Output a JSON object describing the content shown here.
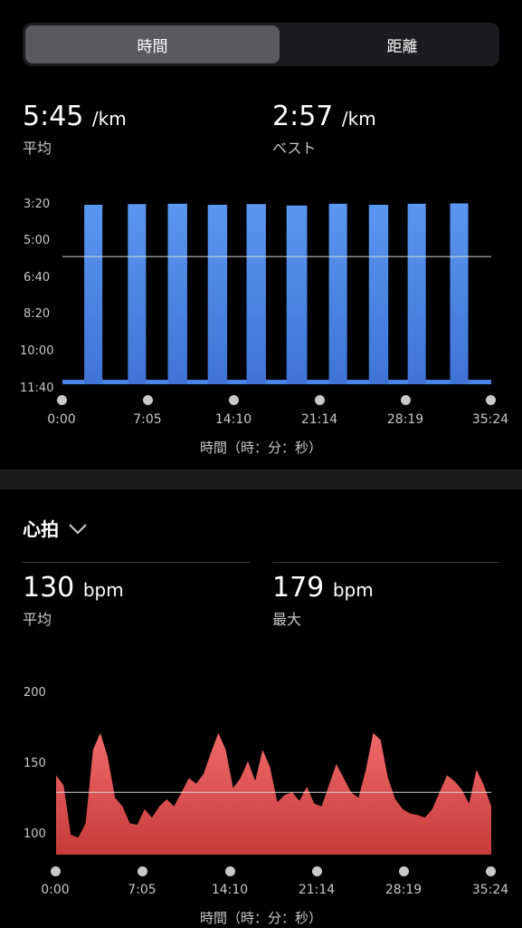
{
  "tabs": [
    {
      "label": "時間",
      "active": true
    },
    {
      "label": "距離",
      "active": false
    }
  ],
  "pace": {
    "average": {
      "value": "5:45",
      "unit": "/km",
      "label": "平均"
    },
    "best": {
      "value": "2:57",
      "unit": "/km",
      "label": "ベスト"
    }
  },
  "heart": {
    "section_title": "心拍",
    "average": {
      "value": "130",
      "unit": "bpm",
      "label": "平均"
    },
    "max": {
      "value": "179",
      "unit": "bpm",
      "label": "最大"
    }
  },
  "colors": {
    "pace": "#4a85e6",
    "heart": "#e04848",
    "background": "#000000"
  },
  "chart_data": [
    {
      "type": "area",
      "x_axis_title": "時間（時：分：秒）",
      "x_ticks": [
        "0:00",
        "7:05",
        "14:10",
        "21:14",
        "28:19",
        "35:24"
      ],
      "y_ticks": [
        "3:20",
        "5:00",
        "6:40",
        "8:20",
        "10:00",
        "11:40"
      ],
      "y_inverted": true,
      "ylim_seconds_per_km": [
        200,
        700
      ],
      "average_line_seconds_per_km": 345,
      "series": [
        {
          "x_min": [
            0,
            1.8,
            3.6,
            5.4,
            7.1,
            8.9,
            10.7,
            12.5,
            14.2,
            16.0,
            17.8,
            19.5,
            21.3,
            23.0,
            24.8,
            26.6,
            28.4,
            30.1,
            31.9,
            33.7,
            35.4
          ],
          "intervals_min": [
            [
              1.8,
              3.3
            ],
            [
              5.4,
              6.9
            ],
            [
              8.7,
              10.3
            ],
            [
              12.0,
              13.6
            ],
            [
              15.2,
              16.8
            ],
            [
              18.5,
              20.2
            ],
            [
              22.0,
              23.5
            ],
            [
              25.3,
              26.9
            ],
            [
              28.5,
              30.0
            ],
            [
              32.0,
              33.5
            ]
          ],
          "interval_pace_seconds_per_km": [
            200,
            198,
            197,
            200,
            198,
            202,
            197,
            200,
            197,
            196
          ],
          "recovery_pace_seconds_per_km": 690
        }
      ]
    },
    {
      "type": "area",
      "x_axis_title": "時間（時：分：秒）",
      "x_ticks": [
        "0:00",
        "7:05",
        "14:10",
        "21:14",
        "28:19",
        "35:24"
      ],
      "y_ticks": [
        "200",
        "150",
        "100"
      ],
      "ylim": [
        90,
        200
      ],
      "average_line": 130,
      "series": [
        {
          "x_min": [
            0.0,
            0.6,
            1.2,
            1.8,
            2.4,
            3.0,
            3.6,
            4.2,
            4.8,
            5.4,
            6.0,
            6.6,
            7.2,
            7.8,
            8.4,
            9.0,
            9.6,
            10.2,
            10.8,
            11.4,
            12.0,
            12.6,
            13.2,
            13.8,
            14.4,
            15.0,
            15.6,
            16.2,
            16.8,
            17.4,
            18.0,
            18.6,
            19.2,
            19.8,
            20.4,
            21.0,
            21.6,
            22.2,
            22.8,
            23.4,
            24.0,
            24.6,
            25.2,
            25.8,
            26.4,
            27.0,
            27.6,
            28.2,
            28.8,
            29.4,
            30.0,
            30.6,
            31.2,
            31.8,
            32.4,
            33.0,
            33.6,
            34.2,
            34.8,
            35.4
          ],
          "bpm": [
            142,
            135,
            100,
            98,
            108,
            160,
            172,
            155,
            126,
            120,
            108,
            107,
            118,
            112,
            120,
            125,
            120,
            130,
            140,
            136,
            143,
            158,
            172,
            160,
            133,
            140,
            152,
            138,
            160,
            148,
            123,
            128,
            130,
            124,
            134,
            122,
            120,
            135,
            150,
            140,
            130,
            126,
            146,
            172,
            167,
            140,
            125,
            118,
            115,
            114,
            112,
            118,
            130,
            142,
            138,
            132,
            122,
            146,
            135,
            120
          ]
        }
      ]
    }
  ]
}
